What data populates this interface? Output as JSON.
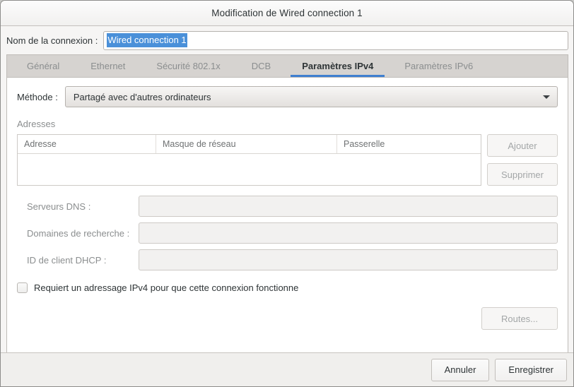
{
  "window": {
    "title": "Modification de Wired connection 1"
  },
  "connection_name": {
    "label": "Nom de la connexion :",
    "value": "Wired connection 1",
    "selected": true
  },
  "tabs": [
    {
      "label": "Général",
      "active": false
    },
    {
      "label": "Ethernet",
      "active": false
    },
    {
      "label": "Sécurité 802.1x",
      "active": false
    },
    {
      "label": "DCB",
      "active": false
    },
    {
      "label": "Paramètres IPv4",
      "active": true
    },
    {
      "label": "Paramètres IPv6",
      "active": false
    }
  ],
  "method": {
    "label": "Méthode :",
    "value": "Partagé avec d'autres ordinateurs",
    "caret_icon": "chevron-down-icon"
  },
  "addresses": {
    "section_label": "Adresses",
    "columns": [
      "Adresse",
      "Masque de réseau",
      "Passerelle"
    ],
    "rows": [],
    "add_button": "Ajouter",
    "delete_button": "Supprimer"
  },
  "fields": [
    {
      "label": "Serveurs DNS :",
      "value": "",
      "placeholder": "",
      "disabled": true
    },
    {
      "label": "Domaines de recherche :",
      "value": "",
      "placeholder": "",
      "disabled": true
    },
    {
      "label": "ID de client DHCP :",
      "value": "",
      "placeholder": "",
      "disabled": true
    }
  ],
  "require_ipv4": {
    "label": "Requiert un adressage IPv4 pour que cette connexion fonctionne",
    "checked": false
  },
  "routes": {
    "label": "Routes...",
    "disabled": true
  },
  "actions": {
    "cancel": "Annuler",
    "save": "Enregistrer"
  },
  "colors": {
    "accent": "#3f7fd0",
    "selection": "#4a90d9",
    "window_bg": "#f6f5f4",
    "tabbar_bg": "#d6d3d0",
    "text": "#2e3436",
    "muted_text": "#8b8e8f"
  }
}
